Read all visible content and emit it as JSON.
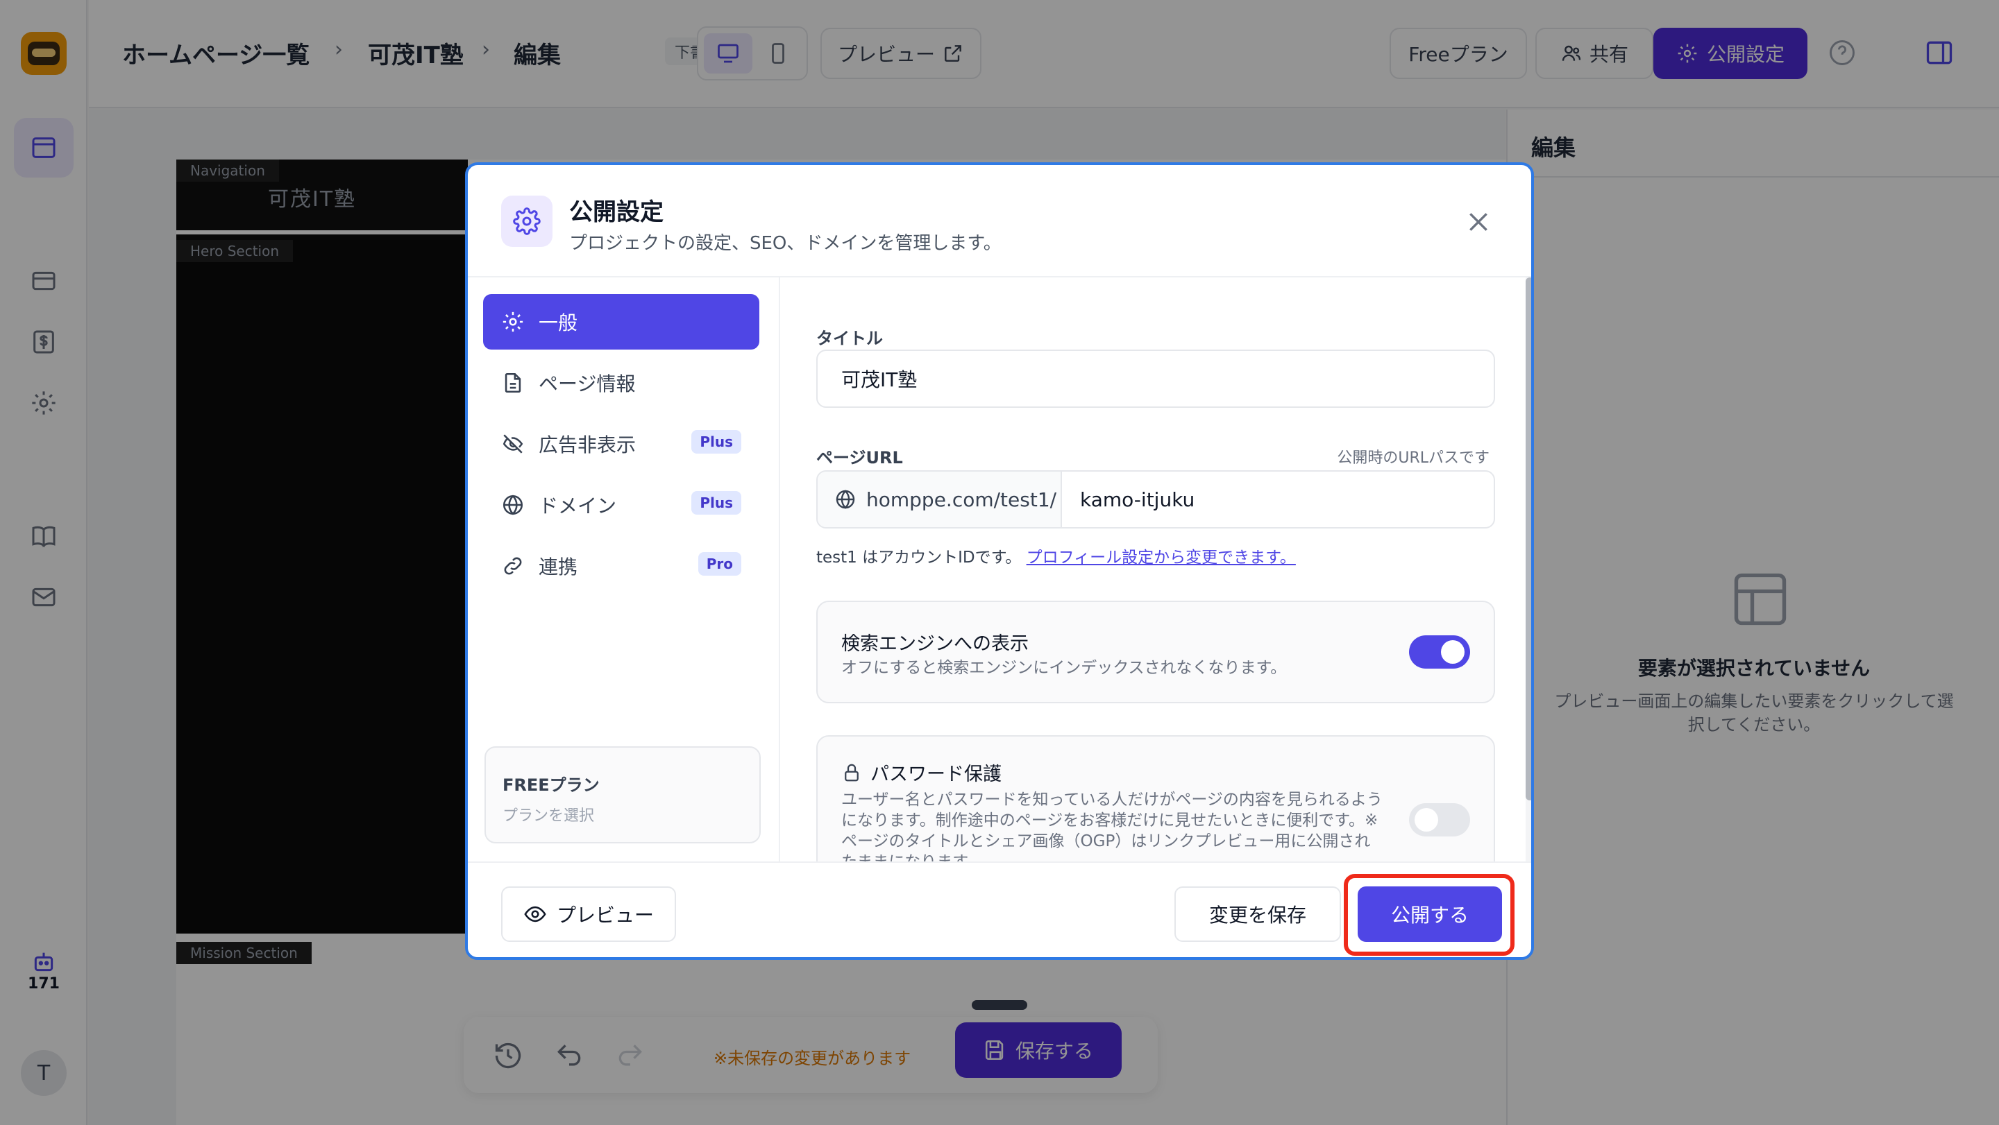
{
  "app": {
    "breadcrumb": [
      "ホームページ一覧",
      "可茂IT塾",
      "編集"
    ],
    "breadcrumb_sep": "›",
    "draft_badge": "下書き",
    "preview_label": "プレビュー",
    "plan_label": "Freeプラン",
    "share_label": "共有",
    "publish_settings_label": "公開設定",
    "sidebar_count": "171",
    "avatar_initial": "T"
  },
  "canvas": {
    "nav_section_tag": "Navigation",
    "hero_section_tag": "Hero Section",
    "mission_section_tag": "Mission Section",
    "nav_logo_text": "可茂IT塾"
  },
  "right_panel": {
    "title": "編集",
    "empty_title": "要素が選択されていません",
    "empty_desc": "プレビュー画面上の編集したい要素をクリックして選択してください。"
  },
  "bottom_toolbar": {
    "unsaved_text": "※未保存の変更があります",
    "save_label": "保存する"
  },
  "modal": {
    "title": "公開設定",
    "subtitle": "プロジェクトの設定、SEO、ドメインを管理します。",
    "nav": [
      {
        "label": "一般",
        "icon": "gear-icon",
        "badge": ""
      },
      {
        "label": "ページ情報",
        "icon": "document-icon",
        "badge": ""
      },
      {
        "label": "広告非表示",
        "icon": "eye-off-icon",
        "badge": "Plus"
      },
      {
        "label": "ドメイン",
        "icon": "globe-icon",
        "badge": "Plus"
      },
      {
        "label": "連携",
        "icon": "link-icon",
        "badge": "Pro"
      }
    ],
    "plan_card": {
      "title": "FREEプラン",
      "subtitle": "プランを選択"
    },
    "form": {
      "title_label": "タイトル",
      "title_value": "可茂IT塾",
      "url_label": "ページURL",
      "url_hint": "公開時のURLパスです",
      "url_prefix": "homppe.com/test1/",
      "url_slug": "kamo-itjuku",
      "url_note": "test1 はアカウントIDです。",
      "url_note_link": "プロフィール設定から変更できます。",
      "seo_title": "検索エンジンへの表示",
      "seo_desc": "オフにすると検索エンジンにインデックスされなくなります。",
      "seo_enabled": true,
      "pw_title": "パスワード保護",
      "pw_desc": "ユーザー名とパスワードを知っている人だけがページの内容を見られるようになります。制作途中のページをお客様だけに見せたいときに便利です。※ページのタイトルとシェア画像（OGP）はリンクプレビュー用に公開されたままになります。",
      "pw_enabled": false
    },
    "footer": {
      "preview_label": "プレビュー",
      "save_label": "変更を保存",
      "publish_label": "公開する"
    }
  },
  "colors": {
    "accent": "#4f46e5",
    "highlight": "#ef2a1a",
    "modal_border": "#2f7ae5"
  }
}
